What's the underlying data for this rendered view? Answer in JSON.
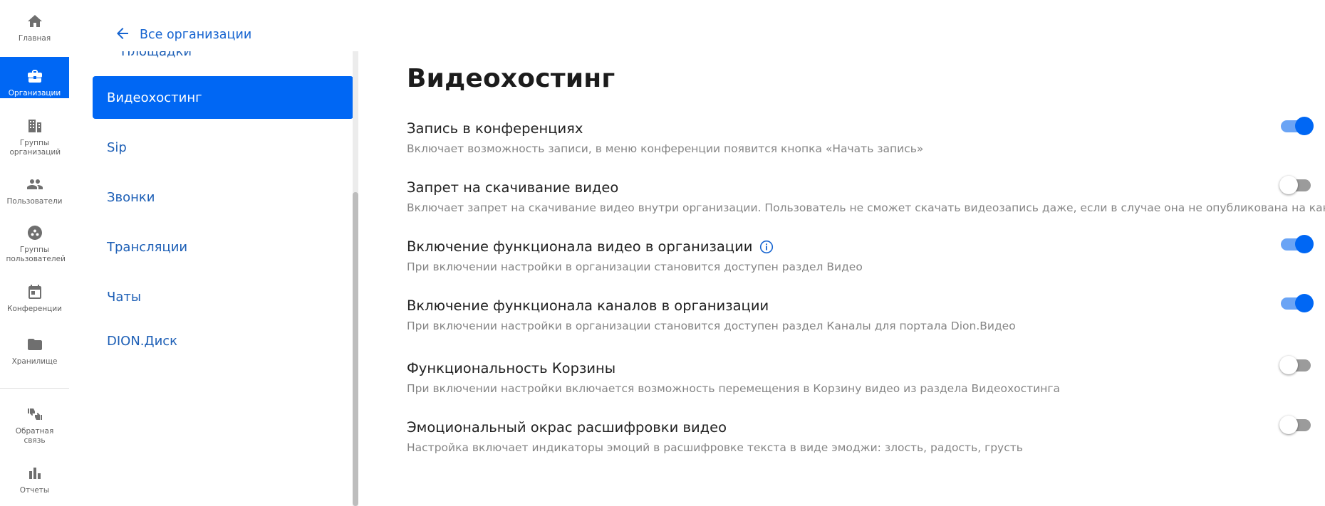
{
  "rail": {
    "items": [
      {
        "label": "Главная",
        "icon": "home-icon"
      },
      {
        "label": "Организации",
        "icon": "briefcase-icon"
      },
      {
        "label": "Группы организаций",
        "icon": "org-groups-icon"
      },
      {
        "label": "Пользователи",
        "icon": "users-icon"
      },
      {
        "label": "Группы пользователей",
        "icon": "user-groups-icon"
      },
      {
        "label": "Конференции",
        "icon": "calendar-icon"
      },
      {
        "label": "Хранилище",
        "icon": "folder-icon"
      },
      {
        "label": "Обратная связь",
        "icon": "feedback-thumbs-icon"
      },
      {
        "label": "Отчеты",
        "icon": "bar-chart-icon"
      }
    ],
    "active_color": "#0067f4"
  },
  "subnav": {
    "back_label": "Все организации",
    "items": [
      {
        "label": "Площадки"
      },
      {
        "label": "Видеохостинг"
      },
      {
        "label": "Sip"
      },
      {
        "label": "Звонки"
      },
      {
        "label": "Трансляции"
      },
      {
        "label": "Чаты"
      },
      {
        "label": "DION.Диск"
      }
    ],
    "active": "Видеохостинг"
  },
  "main": {
    "title": "Видеохостинг",
    "settings": [
      {
        "title": "Запись в конференциях",
        "description": "Включает возможность записи, в меню конференции появится кнопка «Начать запись»",
        "enabled": true
      },
      {
        "title": "Запрет на скачивание видео",
        "description": "Включает запрет на скачивание видео внутри организации. Пользователь не сможет скачать видеозапись даже, если в случае она не опубликована на канале",
        "enabled": false
      },
      {
        "title": "Включение функционала видео в организации",
        "description": "При включении настройки в организации становится доступен раздел Видео",
        "enabled": true,
        "has_info_icon": true
      },
      {
        "title": "Включение функционала каналов в организации",
        "description": "При включении настройки в организации становится доступен раздел Каналы для портала Dion.Видео",
        "enabled": true
      },
      {
        "title": "Функциональность Корзины",
        "description": "При включении настройки включается возможность перемещения в Корзину видео из раздела Видеохостинга",
        "enabled": false
      },
      {
        "title": "Эмоциональный окрас расшифровки видео",
        "description": "Настройка включает индикаторы эмоций в расшифровке текста в виде эмоджи: злость, радость, грусть",
        "enabled": false
      }
    ]
  },
  "colors": {
    "accent": "#0067f4",
    "link": "#1d5fb6",
    "toggle_on_track": "#6aa4f5",
    "toggle_off_track": "#9b9b9b"
  }
}
